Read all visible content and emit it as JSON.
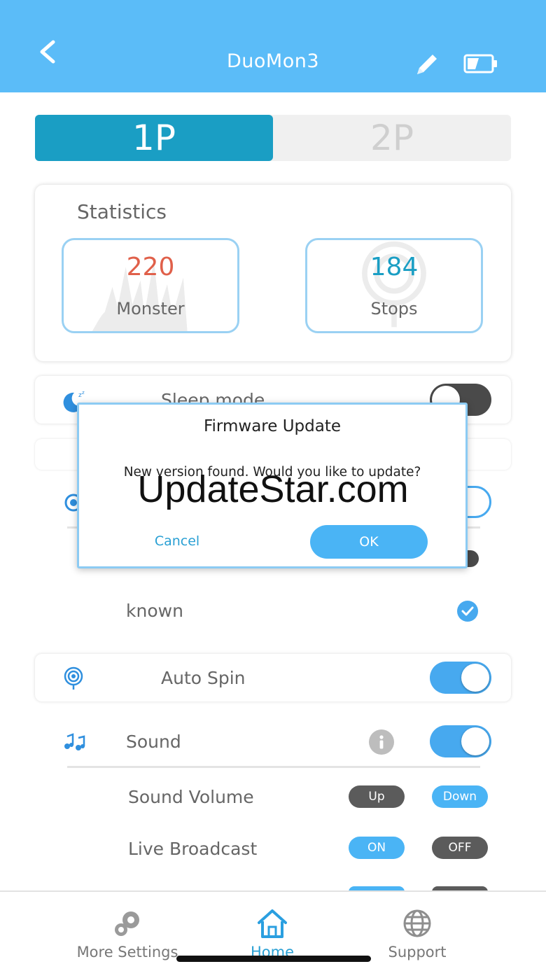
{
  "header": {
    "title": "DuoMon3",
    "back_icon": "chevron-left-icon",
    "edit_icon": "pencil-icon",
    "battery_icon": "battery-icon"
  },
  "segment": {
    "tab1": "1P",
    "tab2": "2P",
    "active": "1P"
  },
  "statistics": {
    "title": "Statistics",
    "items": [
      {
        "value": "220",
        "label": "Monster",
        "value_color": "#e0604a"
      },
      {
        "value": "184",
        "label": "Stops",
        "value_color": "#1a9ec4"
      }
    ]
  },
  "settings": {
    "sleep_mode": {
      "label": "Sleep mode",
      "icon": "moon-icon",
      "state": "off"
    },
    "known": {
      "label": "known",
      "checked": true
    },
    "auto_spin": {
      "label": "Auto Spin",
      "icon": "spin-icon",
      "state": "on"
    },
    "sound": {
      "label": "Sound",
      "icon": "music-icon",
      "info_icon": "info-icon",
      "state": "on"
    },
    "sound_volume": {
      "label": "Sound Volume",
      "up": "Up",
      "down": "Down"
    },
    "live_broadcast": {
      "label": "Live Broadcast",
      "on": "ON",
      "off": "OFF"
    }
  },
  "dialog": {
    "title": "Firmware Update",
    "message": "New version found. Would you like to update?",
    "cancel": "Cancel",
    "ok": "OK"
  },
  "watermark": "UpdateStar.com",
  "tabbar": {
    "items": [
      {
        "label": "More Settings",
        "icon": "gears-icon"
      },
      {
        "label": "Home",
        "icon": "home-icon",
        "active": true
      },
      {
        "label": "Support",
        "icon": "globe-icon"
      }
    ]
  },
  "colors": {
    "header": "#5bbcf8",
    "accent": "#1a9ec4",
    "toggle_on": "#47a9ef"
  }
}
